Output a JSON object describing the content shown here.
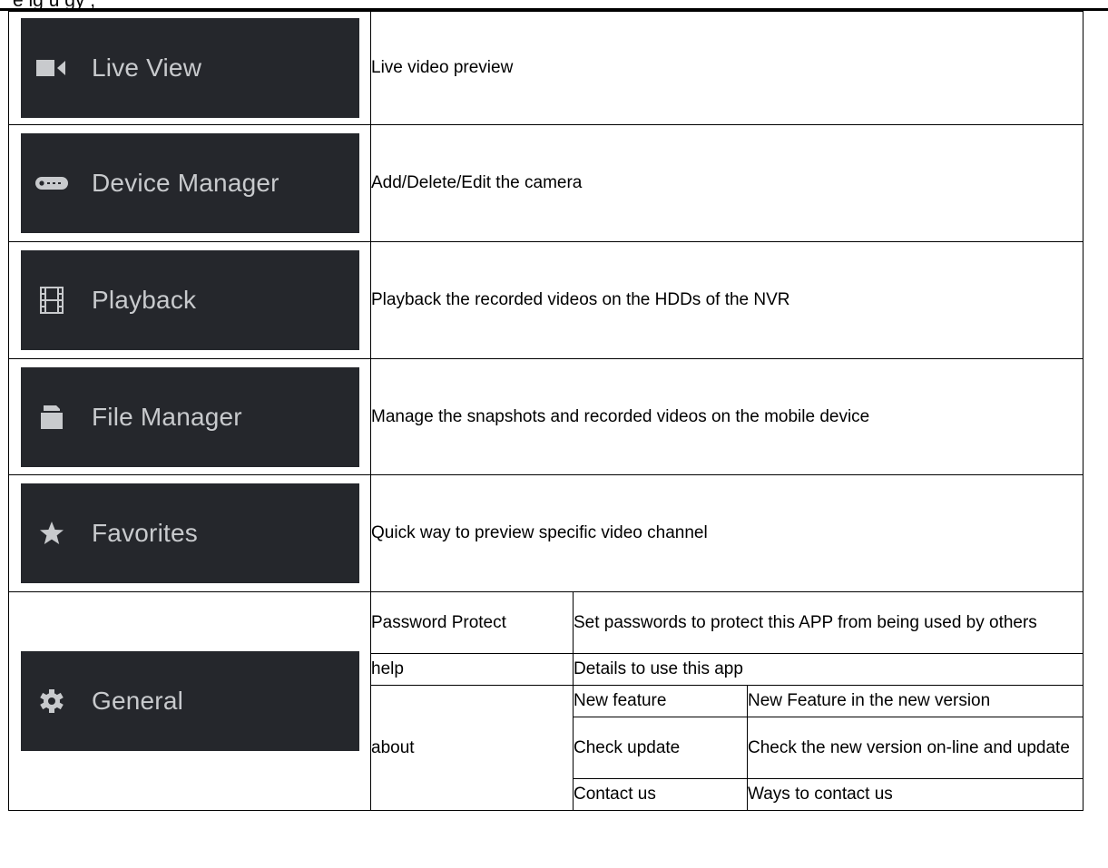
{
  "header": {
    "partial_text": "e ig     u     gy  ,  "
  },
  "rows": [
    {
      "button": {
        "label": "Live View",
        "icon": "video-camera-icon"
      },
      "description": "Live video preview"
    },
    {
      "button": {
        "label": "Device Manager",
        "icon": "device-icon"
      },
      "description": "Add/Delete/Edit the camera"
    },
    {
      "button": {
        "label": "Playback",
        "icon": "film-icon"
      },
      "description": "Playback the recorded videos on the HDDs of the NVR"
    },
    {
      "button": {
        "label": "File Manager",
        "icon": "folder-icon"
      },
      "description": "Manage the snapshots and recorded videos on the mobile device"
    },
    {
      "button": {
        "label": "Favorites",
        "icon": "star-icon"
      },
      "description": "Quick way to preview specific video channel"
    }
  ],
  "general": {
    "button": {
      "label": "General",
      "icon": "gear-icon"
    },
    "password_protect": {
      "label": "Password Protect",
      "description": "Set passwords to protect this APP from being used by others"
    },
    "help": {
      "label": "help",
      "description": "Details to use this app"
    },
    "about": {
      "label": "about",
      "items": [
        {
          "label": "New feature",
          "description": "New Feature in the new version"
        },
        {
          "label": "Check update",
          "description": "Check the new version on-line and update"
        },
        {
          "label": "Contact us",
          "description": "Ways to contact us"
        }
      ]
    }
  },
  "colors": {
    "button_bg": "#25272c",
    "button_text": "#c8cacd"
  }
}
